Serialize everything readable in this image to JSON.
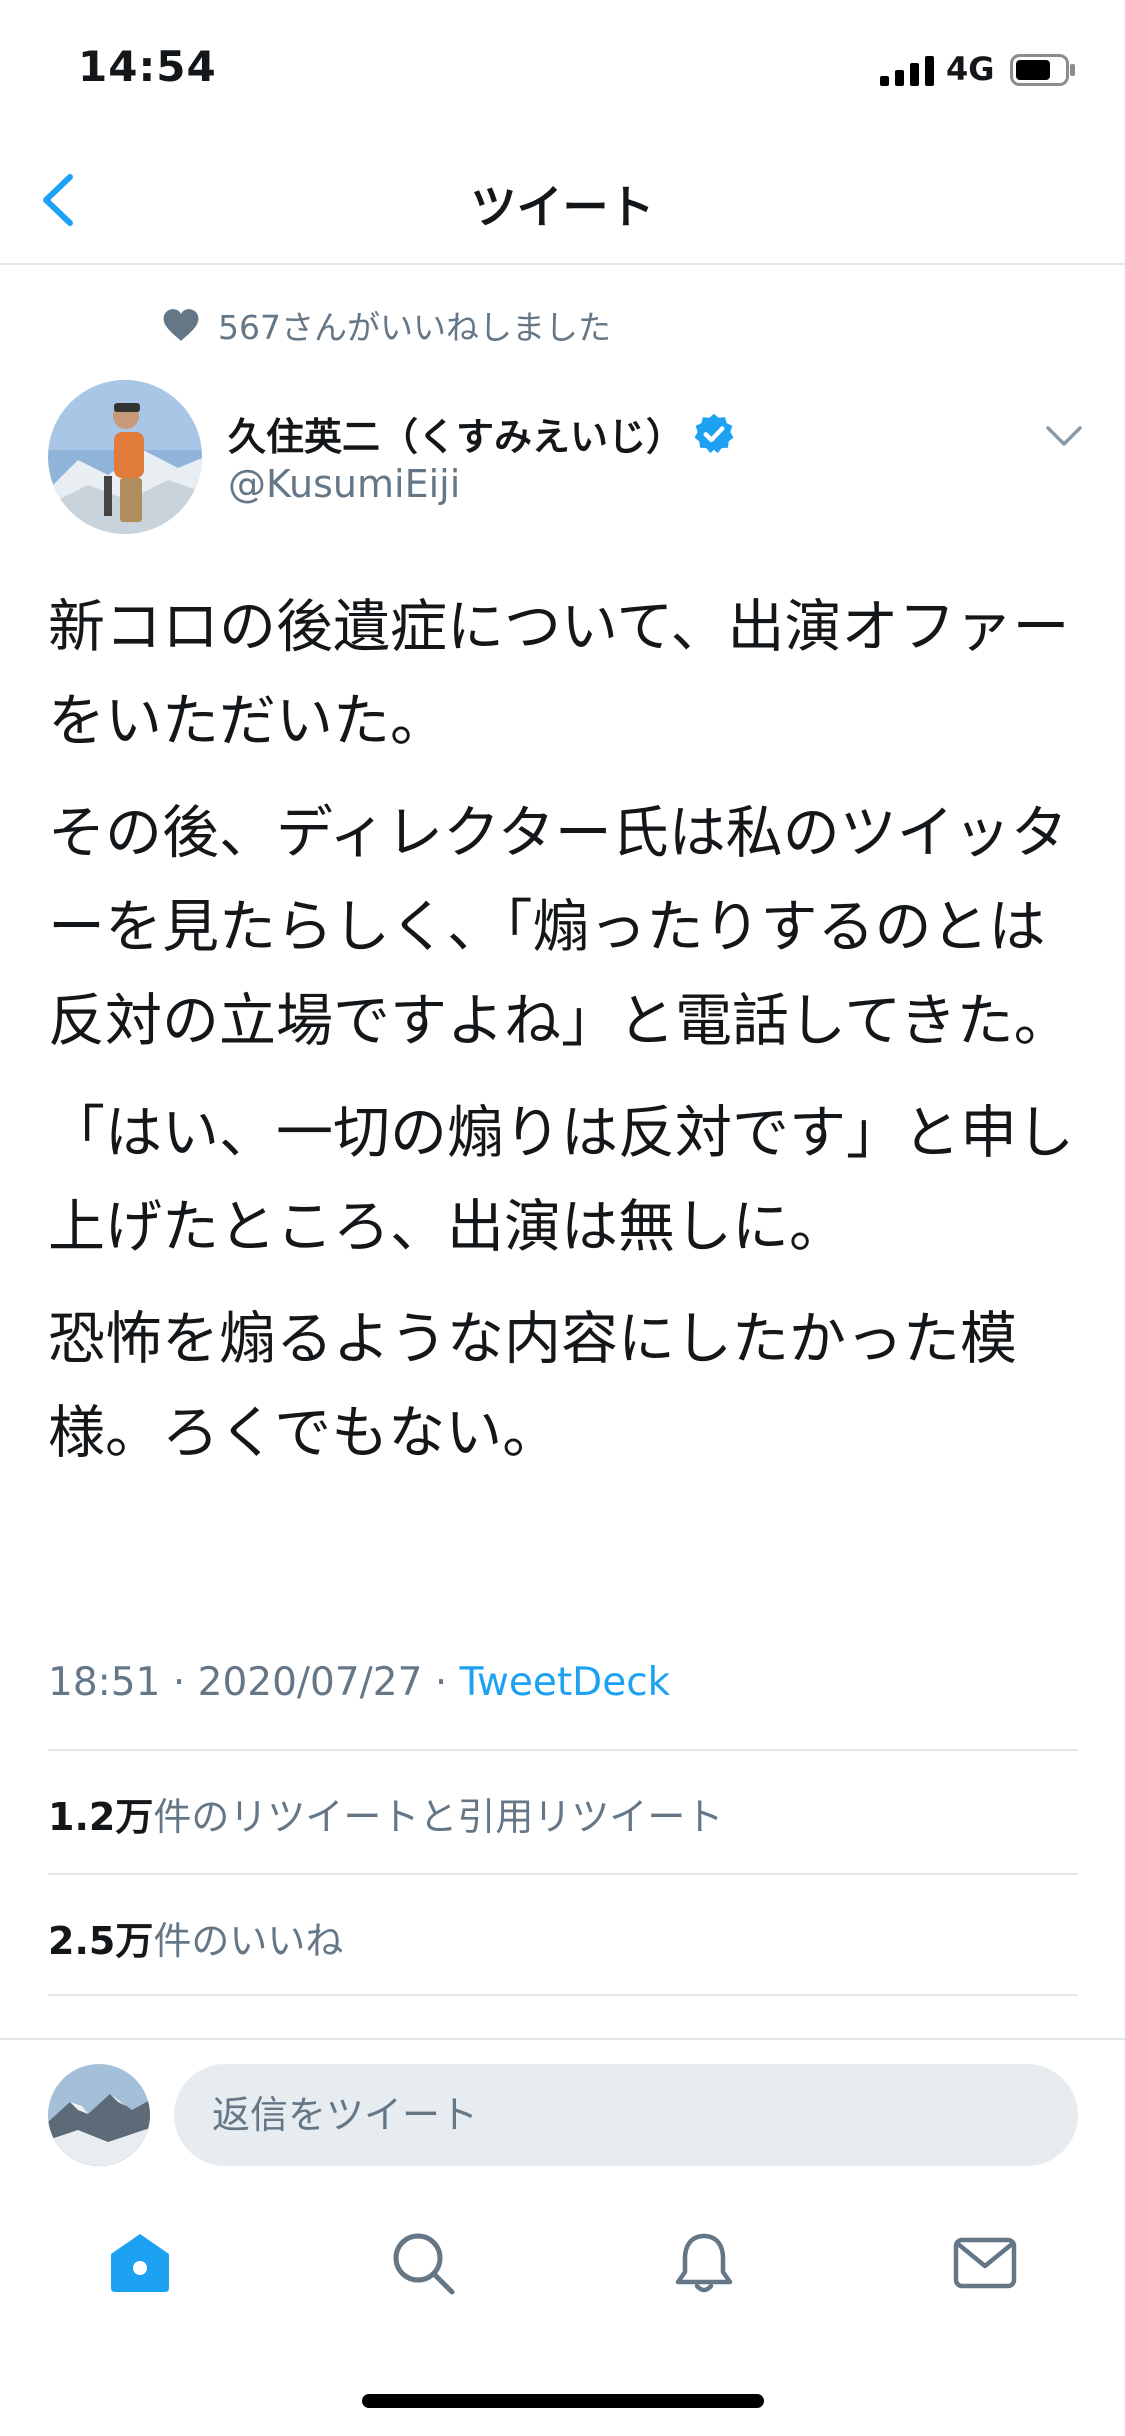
{
  "status_bar": {
    "time": "14:54",
    "network": "4G"
  },
  "nav": {
    "title": "ツイート"
  },
  "liked_by": "567さんがいいねしました",
  "author": {
    "name": "久住英二（くすみえいじ）",
    "handle": "@KusumiEiji"
  },
  "tweet": {
    "paragraphs": [
      "新コロの後遺症について、出演オファーをいただいた。",
      "その後、ディレクター氏は私のツイッターを見たらしく、「煽ったりするのとは反対の立場ですよね」と電話してきた。",
      "「はい、一切の煽りは反対です」と申し上げたところ、出演は無しに。",
      "恐怖を煽るような内容にしたかった模様。ろくでもない。"
    ],
    "time": "18:51",
    "separator": "·",
    "date": "2020/07/27",
    "source": "TweetDeck"
  },
  "stats": {
    "retweets_count": "1.2万",
    "retweets_label": "件のリツイートと引用リツイート",
    "likes_count": "2.5万",
    "likes_label": "件のいいね"
  },
  "reply": {
    "placeholder": "返信をツイート"
  },
  "colors": {
    "accent": "#1da1f2",
    "secondary_text": "#657786",
    "divider": "#e1e8ed"
  },
  "icons": {
    "back": "chevron-left-icon",
    "verified": "verified-badge-icon",
    "caret": "chevron-down-icon",
    "tabs": [
      "home-icon",
      "search-icon",
      "bell-icon",
      "mail-icon"
    ]
  }
}
